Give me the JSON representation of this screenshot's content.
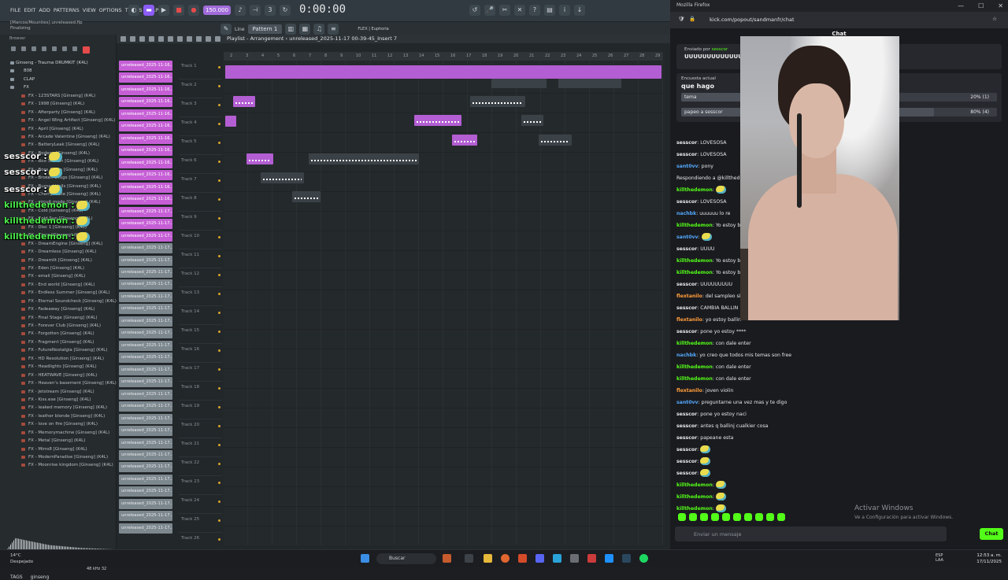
{
  "fl": {
    "menu": [
      "FILE",
      "EDIT",
      "ADD",
      "PATTERNS",
      "VIEW",
      "OPTIONS",
      "TOOLS",
      "HELP"
    ],
    "bpm": "150.000",
    "time": "0:00:00",
    "project_line1": "[Marcos/Mounties] unreleased.flp",
    "project_line2": "Finalizing",
    "pattern": "Pattern 1",
    "snap": "Line",
    "plugin": "FLEX | Euphoria",
    "playlist_title": "Playlist - Arrangement › unreleased_2025-11-17 00-39-45_Insert 7",
    "browser_label": "Browser",
    "tags_label": "TAGS",
    "tags_value": "ginseng",
    "root_folder": "Ginseng - Trauma DRUMKIT (K4L)",
    "folders": [
      "808",
      "CLAP",
      "FX"
    ],
    "fx_items": [
      "FX - 123STARS [Ginseng] (K4L)",
      "FX - 1998 [Ginseng] (K4L)",
      "FX - Afterparty [Ginseng] (K4L)",
      "FX - Angel Wing Artifact [Ginseng] (K4L)",
      "FX - April [Ginseng] (K4L)",
      "FX - Arcade Valentine [Ginseng] (K4L)",
      "FX - BatteryLeak [Ginseng] (K4L)",
      "FX - Bodega [Ginseng] (K4L)",
      "FX - Bolt Station [Ginseng] (K4L)",
      "FX - Boss Arena [Ginseng] (K4L)",
      "FX - Broken Drugs [Ginseng] (K4L)",
      "FX - Burned Halls [Ginseng] (K4L)",
      "FX - Cherry State [Ginseng] (K4L)",
      "FX - circuit mode [Ginseng] (K4L)",
      "FX - Cold [Ginseng] (K4L)",
      "FX - Cold Sun [Ginseng] (K4L)",
      "FX - Disc 1 [Ginseng] (K4L)",
      "FX - Disco [Ginseng] (K4L)",
      "FX - DreamEngine [Ginseng] (K4L)",
      "FX - Dreamless [Ginseng] (K4L)",
      "FX - Dreamlit [Ginseng] (K4L)",
      "FX - Eden [Ginseng] (K4L)",
      "FX - email [Ginseng] (K4L)",
      "FX - End world [Ginseng] (K4L)",
      "FX - Endless Summer [Ginseng] (K4L)",
      "FX - Eternal Soundcheck [Ginseng] (K4L)",
      "FX - Fadeaway [Ginseng] (K4L)",
      "FX - Final Stage [Ginseng] (K4L)",
      "FX - Forever Club [Ginseng] (K4L)",
      "FX - Forgotten [Ginseng] (K4L)",
      "FX - Fragment [Ginseng] (K4L)",
      "FX - FutureNostalgia [Ginseng] (K4L)",
      "FX - HD Resolution [Ginseng] (K4L)",
      "FX - Headlights [Ginseng] (K4L)",
      "FX - HEATWAVE [Ginseng] (K4L)",
      "FX - Heaven's basement [Ginseng] (K4L)",
      "FX - Jetstream [Ginseng] (K4L)",
      "FX - Kiss.exe [Ginseng] (K4L)",
      "FX - leaked memory [Ginseng] (K4L)",
      "FX - leather blonde [Ginseng] (K4L)",
      "FX - love on fire [Ginseng] (K4L)",
      "FX - Memorymachine [Ginseng] (K4L)",
      "FX - Metal [Ginseng] (K4L)",
      "FX - Mirro8 [Ginseng] (K4L)",
      "FX - ModernParadise [Ginseng] (K4L)",
      "FX - Moonrise kingdom [Ginseng] (K4L)"
    ],
    "clips": [
      "unreleased_2025-11-16...",
      "unreleased_2025-11-16...",
      "unreleased_2025-11-16...",
      "unreleased_2025-11-16...",
      "unreleased_2025-11-16...",
      "unreleased_2025-11-16...",
      "unreleased_2025-11-16...",
      "unreleased_2025-11-16...",
      "unreleased_2025-11-16...",
      "unreleased_2025-11-16...",
      "unreleased_2025-11-16...",
      "unreleased_2025-11-16...",
      "unreleased_2025-11-17...",
      "unreleased_2025-11-17...",
      "unreleased_2025-11-17...",
      "unreleased_2025-11-17...",
      "unreleased_2025-11-17...",
      "unreleased_2025-11-17...",
      "unreleased_2025-11-17...",
      "unreleased_2025-11-17...",
      "unreleased_2025-11-17...",
      "unreleased_2025-11-17...",
      "unreleased_2025-11-17...",
      "unreleased_2025-11-17...",
      "unreleased_2025-11-17...",
      "unreleased_2025-11-17...",
      "unreleased_2025-11-17...",
      "unreleased_2025-11-17...",
      "unreleased_2025-11-17...",
      "unreleased_2025-11-17...",
      "unreleased_2025-11-17...",
      "unreleased_2025-11-17...",
      "unreleased_2025-11-17...",
      "unreleased_2025-11-17...",
      "unreleased_2025-11-17...",
      "unreleased_2025-11-17...",
      "unreleased_2025-11-17...",
      "unreleased_2025-11-17...",
      "unreleased_2025-11-17..."
    ],
    "tracks": [
      "Track 1",
      "Track 2",
      "Track 3",
      "Track 4",
      "Track 5",
      "Track 6",
      "Track 7",
      "Track 8",
      "Track 9",
      "Track 10",
      "Track 11",
      "Track 12",
      "Track 13",
      "Track 14",
      "Track 15",
      "Track 16",
      "Track 17",
      "Track 18",
      "Track 19",
      "Track 20",
      "Track 21",
      "Track 22",
      "Track 23",
      "Track 24",
      "Track 25",
      "Track 26"
    ],
    "ruler": [
      "2",
      "3",
      "4",
      "5",
      "6",
      "7",
      "8",
      "9",
      "10",
      "11",
      "12",
      "13",
      "14",
      "15",
      "16",
      "17",
      "18",
      "19",
      "20",
      "21",
      "22",
      "23",
      "24",
      "25",
      "26",
      "27",
      "28",
      "29"
    ],
    "wave_info": "48 kHz 32",
    "overlays": [
      {
        "user": "sesscor :",
        "color": "white"
      },
      {
        "user": "sesscor :",
        "color": "white"
      },
      {
        "user": "sesscor :",
        "color": "white"
      },
      {
        "user": "killthedemon :",
        "color": "green"
      },
      {
        "user": "killthedemon :",
        "color": "green"
      },
      {
        "user": "killthedemon :",
        "color": "green"
      }
    ]
  },
  "ff": {
    "title": "Mozilla Firefox",
    "url": "kick.com/popout/sandmanfr/chat",
    "chat_title": "Chat",
    "pinned_by": "Enviado por",
    "pinned_user": "sesscor",
    "pinned_msg": "UUUUUUUUUUUUUUUUUUUUUUU",
    "poll_label": "Encuesta actual",
    "poll_question": "que hago",
    "poll_options": [
      {
        "label": "tema",
        "pct": "20% (1)",
        "fill": 0.2
      },
      {
        "label": "papeo a sesscor",
        "pct": "80% (4)",
        "fill": 0.8
      }
    ],
    "messages": [
      {
        "user": "sesscor",
        "color": "#e5e7ea",
        "text": "LOVESOSA"
      },
      {
        "user": "sesscor",
        "color": "#e5e7ea",
        "text": "LOVESOSA"
      },
      {
        "user": "sant0vv",
        "color": "#53a8fc",
        "text": "pony"
      },
      {
        "user": "",
        "color": "#8e939a",
        "text": "Respondiendo a @killthed..."
      },
      {
        "user": "killthedemon",
        "color": "#53fc18",
        "text": ""
      },
      {
        "user": "sesscor",
        "color": "#e5e7ea",
        "text": "LOVESOSA"
      },
      {
        "user": "nachbk",
        "color": "#53a8fc",
        "text": "uuuuuu lo re"
      },
      {
        "user": "killthedemon",
        "color": "#53fc18",
        "text": "Yo estoy b"
      },
      {
        "user": "sant0vv",
        "color": "#53a8fc",
        "text": ""
      },
      {
        "user": "sesscor",
        "color": "#e5e7ea",
        "text": "UUUU"
      },
      {
        "user": "killthedemon",
        "color": "#53fc18",
        "text": "Yo estoy b"
      },
      {
        "user": "killthedemon",
        "color": "#53fc18",
        "text": "Yo estoy b"
      },
      {
        "user": "sesscor",
        "color": "#e5e7ea",
        "text": "UUUUUUUUU"
      },
      {
        "user": "flextanilo",
        "color": "#ff9d3c",
        "text": "del sampleo si"
      },
      {
        "user": "sesscor",
        "color": "#e5e7ea",
        "text": "CAMBIA BALLIN"
      },
      {
        "user": "flextanilo",
        "color": "#ff9d3c",
        "text": "yo estoy ballin"
      },
      {
        "user": "sesscor",
        "color": "#e5e7ea",
        "text": "pone yo estoy ****"
      },
      {
        "user": "killthedemon",
        "color": "#53fc18",
        "text": "con dale enter"
      },
      {
        "user": "nachbk",
        "color": "#53a8fc",
        "text": "yo creo que todos mis temas son free"
      },
      {
        "user": "killthedemon",
        "color": "#53fc18",
        "text": "con dale enter"
      },
      {
        "user": "killthedemon",
        "color": "#53fc18",
        "text": "con dale enter"
      },
      {
        "user": "flextanilo",
        "color": "#ff9d3c",
        "text": "joven violin"
      },
      {
        "user": "sant0vv",
        "color": "#53a8fc",
        "text": "preguntarne una vez mas y te digo"
      },
      {
        "user": "sesscor",
        "color": "#e5e7ea",
        "text": "pone yo estoy naci"
      },
      {
        "user": "sesscor",
        "color": "#e5e7ea",
        "text": "antes q ballinj cualkier cosa"
      },
      {
        "user": "sesscor",
        "color": "#e5e7ea",
        "text": "papeane esta"
      },
      {
        "user": "sesscor",
        "color": "#e5e7ea",
        "text": ""
      },
      {
        "user": "sesscor",
        "color": "#e5e7ea",
        "text": ""
      },
      {
        "user": "sesscor",
        "color": "#e5e7ea",
        "text": ""
      },
      {
        "user": "killthedemon",
        "color": "#53fc18",
        "text": ""
      },
      {
        "user": "killthedemon",
        "color": "#53fc18",
        "text": ""
      },
      {
        "user": "killthedemon",
        "color": "#53fc18",
        "text": ""
      }
    ],
    "input_placeholder": "Enviar un mensaje",
    "send_label": "Chat",
    "activate_title": "Activar Windows",
    "activate_sub": "Ve a Configuración para activar Windows."
  },
  "taskbar": {
    "weather_temp": "14°C",
    "weather_desc": "Despejado",
    "search": "Buscar",
    "lang": "ESP LAA",
    "time": "12:53 a. m.",
    "date": "17/11/2025"
  }
}
